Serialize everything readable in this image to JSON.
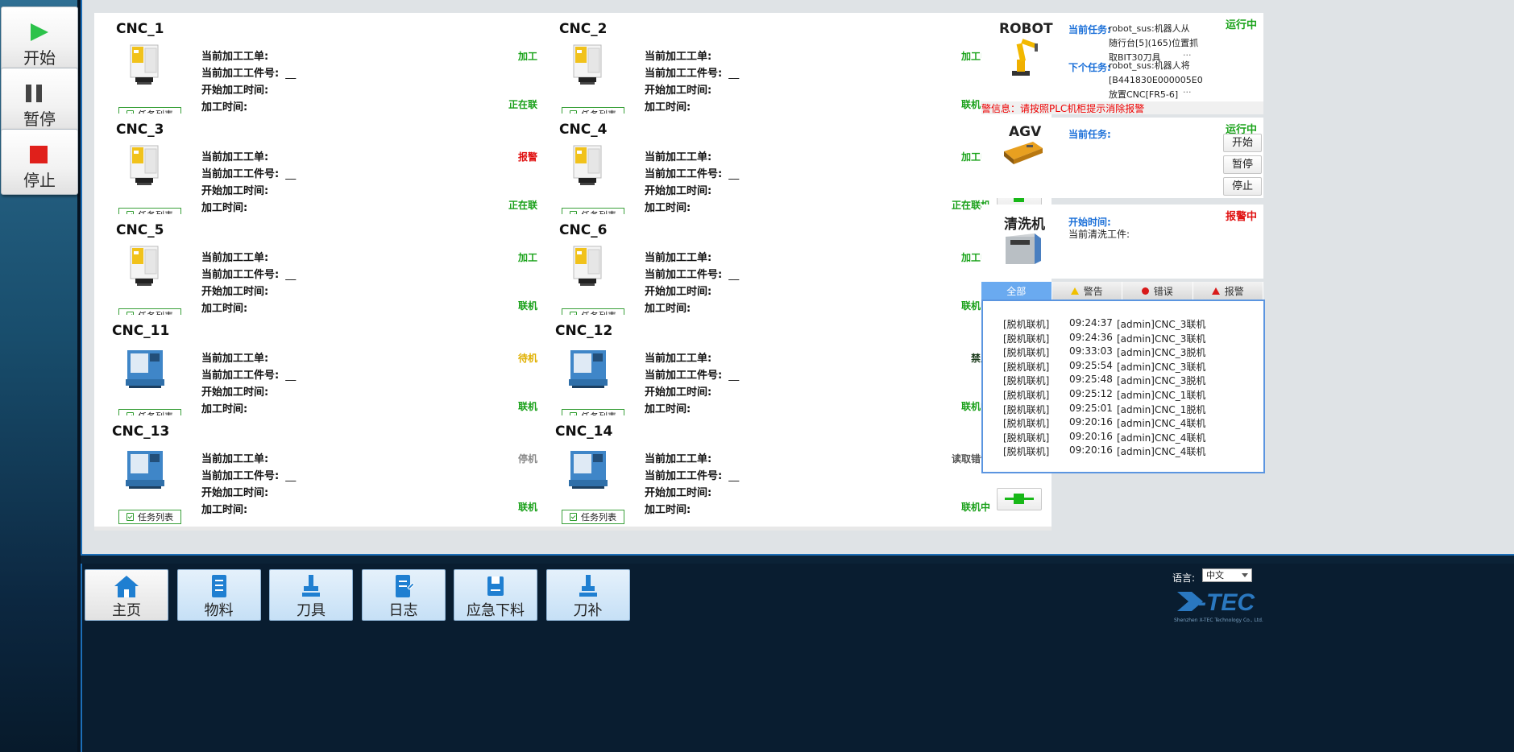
{
  "controls": [
    {
      "label": "开始",
      "icon": "play-icon"
    },
    {
      "label": "暂停",
      "icon": "pause-icon"
    },
    {
      "label": "停止",
      "icon": "stop-icon"
    }
  ],
  "field_labels": {
    "order": "当前加工工单:",
    "part_no": "当前加工工件号:",
    "start_time": "开始加工时间:",
    "duration": "加工时间:",
    "dash": "__",
    "task_list": "任务列表"
  },
  "cncs": [
    {
      "name": "CNC_1",
      "status": "加工中",
      "status_color": "#1aa31a",
      "box_color": "#33cc22",
      "link": "正在联机",
      "machine": "yellow-cnc"
    },
    {
      "name": "CNC_2",
      "status": "加工中",
      "status_color": "#1aa31a",
      "box_color": "#33cc22",
      "link": "联机中",
      "machine": "yellow-cnc"
    },
    {
      "name": "CNC_3",
      "status": "报警中",
      "status_color": "#e01010",
      "box_color": "#ff0000",
      "link": "正在联机",
      "machine": "yellow-cnc"
    },
    {
      "name": "CNC_4",
      "status": "加工中",
      "status_color": "#1aa31a",
      "box_color": "#33cc22",
      "link": "正在联机",
      "machine": "yellow-cnc"
    },
    {
      "name": "CNC_5",
      "status": "加工中",
      "status_color": "#1aa31a",
      "box_color": "#33cc22",
      "link": "联机中",
      "machine": "yellow-cnc"
    },
    {
      "name": "CNC_6",
      "status": "加工中",
      "status_color": "#1aa31a",
      "box_color": "#33cc22",
      "link": "联机中",
      "machine": "yellow-cnc"
    },
    {
      "name": "CNC_11",
      "status": "待机中",
      "status_color": "#e0b000",
      "box_color": "#e6b800",
      "link": "联机中",
      "machine": "blue-cnc"
    },
    {
      "name": "CNC_12",
      "status": "禁用",
      "status_color": "#1e3d1e",
      "box_color": "#234523",
      "link": "联机中",
      "machine": "blue-cnc"
    },
    {
      "name": "CNC_13",
      "status": "停机中",
      "status_color": "#8a8a8a",
      "box_color": "#9a9d9f",
      "link": "联机中",
      "machine": "blue-cnc"
    },
    {
      "name": "CNC_14",
      "status": "读取错误",
      "status_color": "#555555",
      "box_color": "#666a68",
      "link": "联机中",
      "machine": "blue-cnc"
    }
  ],
  "robot": {
    "title": "ROBOT",
    "status": "运行中",
    "current_task_label": "当前任务:",
    "current_task_lines": [
      "robot_sus:机器人从",
      "随行台[5](165)位置抓",
      "取BIT30刀具"
    ],
    "next_task_label": "下个任务:",
    "next_task_lines": [
      "robot_sus:机器人将",
      "[B441830E000005E0",
      "放置CNC[FR5-6]"
    ],
    "more": "···"
  },
  "alarm_info": "警信息：请按照PLC机柜提示消除报警",
  "agv": {
    "title": "AGV",
    "status": "运行中",
    "current_task_label": "当前任务:",
    "buttons": [
      "开始",
      "暂停",
      "停止"
    ]
  },
  "washer": {
    "title": "清洗机",
    "status": "报警中",
    "start_time_label": "开始时间:",
    "current_part_label": "当前清洗工件:"
  },
  "log_tabs": [
    {
      "label": "全部",
      "icon": "",
      "active": true
    },
    {
      "label": "警告",
      "icon": "warning-icon",
      "active": false
    },
    {
      "label": "错误",
      "icon": "error-icon",
      "active": false
    },
    {
      "label": "报警",
      "icon": "alarm-icon",
      "active": false
    }
  ],
  "logs": [
    {
      "type": "[脱机联机]",
      "time": "09:24:37",
      "msg": "[admin]CNC_3联机"
    },
    {
      "type": "[脱机联机]",
      "time": "09:24:36",
      "msg": "[admin]CNC_3联机"
    },
    {
      "type": "[脱机联机]",
      "time": "09:33:03",
      "msg": "[admin]CNC_3脱机"
    },
    {
      "type": "[脱机联机]",
      "time": "09:25:54",
      "msg": "[admin]CNC_3联机"
    },
    {
      "type": "[脱机联机]",
      "time": "09:25:48",
      "msg": "[admin]CNC_3脱机"
    },
    {
      "type": "[脱机联机]",
      "time": "09:25:12",
      "msg": "[admin]CNC_1联机"
    },
    {
      "type": "[脱机联机]",
      "time": "09:25:01",
      "msg": "[admin]CNC_1脱机"
    },
    {
      "type": "[脱机联机]",
      "time": "09:20:16",
      "msg": "[admin]CNC_4联机"
    },
    {
      "type": "[脱机联机]",
      "time": "09:20:16",
      "msg": "[admin]CNC_4联机"
    },
    {
      "type": "[脱机联机]",
      "time": "09:20:16",
      "msg": "[admin]CNC_4联机"
    }
  ],
  "nav": [
    {
      "label": "主页",
      "icon": "home-icon"
    },
    {
      "label": "物料",
      "icon": "material-icon"
    },
    {
      "label": "刀具",
      "icon": "tool-icon"
    },
    {
      "label": "日志",
      "icon": "log-icon"
    },
    {
      "label": "应急下料",
      "icon": "emergency-unload-icon"
    },
    {
      "label": "刀补",
      "icon": "tool-offset-icon"
    }
  ],
  "language": {
    "label": "语言:",
    "value": "中文"
  },
  "brand": {
    "logo": "X-TEC",
    "sub": "Shenzhen X-TEC Technology Co., Ltd."
  }
}
